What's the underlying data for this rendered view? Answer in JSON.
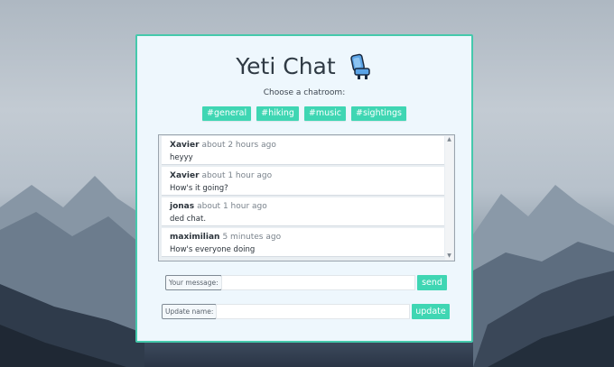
{
  "app": {
    "title": "Yeti Chat",
    "subtitle": "Choose a chatroom:"
  },
  "rooms": [
    {
      "label": "#general"
    },
    {
      "label": "#hiking"
    },
    {
      "label": "#music"
    },
    {
      "label": "#sightings"
    }
  ],
  "messages": [
    {
      "user": "Xavier",
      "time": "about 2 hours ago",
      "text": "heyyy"
    },
    {
      "user": "Xavier",
      "time": "about 1 hour ago",
      "text": "How's it going?"
    },
    {
      "user": "jonas",
      "time": "about 1 hour ago",
      "text": "ded chat."
    },
    {
      "user": "maximilian",
      "time": "5 minutes ago",
      "text": "How's everyone doing"
    }
  ],
  "message_form": {
    "label": "Your message:",
    "value": "",
    "button": "send"
  },
  "name_form": {
    "label": "Update name:",
    "value": "",
    "button": "update"
  },
  "icons": {
    "title_icon": "chair-icon",
    "scroll_up": "chevron-up-icon",
    "scroll_down": "chevron-down-icon"
  },
  "colors": {
    "accent": "#3fd6b3",
    "card_border": "#45c9ac",
    "card_background": "#eef7fd"
  }
}
